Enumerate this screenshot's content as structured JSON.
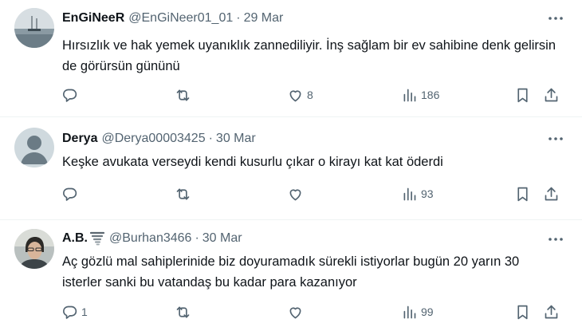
{
  "tweets": [
    {
      "display_name": "EnGiNeeR",
      "handle": "@EnGiNeer01_01",
      "separator": "·",
      "date": "29 Mar",
      "text": "Hırsızlık ve hak yemek uyanıklık zannediliyir. İnş sağlam bir ev sahibine denk gelirsin de görürsün gününü",
      "replies": "",
      "retweets": "",
      "likes": "8",
      "views": "186",
      "avatar": "sea-landscape-avatar"
    },
    {
      "display_name": "Derya",
      "handle": "@Derya00003425",
      "separator": "·",
      "date": "30 Mar",
      "text": "Keşke avukata verseydi kendi kusurlu çıkar o kirayı kat kat öderdi",
      "replies": "",
      "retweets": "",
      "likes": "",
      "views": "93",
      "avatar": "default-profile-avatar"
    },
    {
      "display_name": "A.B.",
      "handle": "@Burhan3466",
      "separator": "·",
      "date": "30 Mar",
      "text": "Aç gözlü mal sahiplerinide biz doyuramadık  sürekli istiyorlar bugün 20 yarın 30 isterler sanki bu vatandaş bu kadar para kazanıyor",
      "replies": "1",
      "retweets": "",
      "likes": "",
      "views": "99",
      "avatar": "person-photo-avatar",
      "name_emoji": "tornado-icon"
    }
  ],
  "colors": {
    "text_primary": "#0f1419",
    "text_secondary": "#536471",
    "divider": "#eff3f4",
    "background": "#ffffff"
  }
}
